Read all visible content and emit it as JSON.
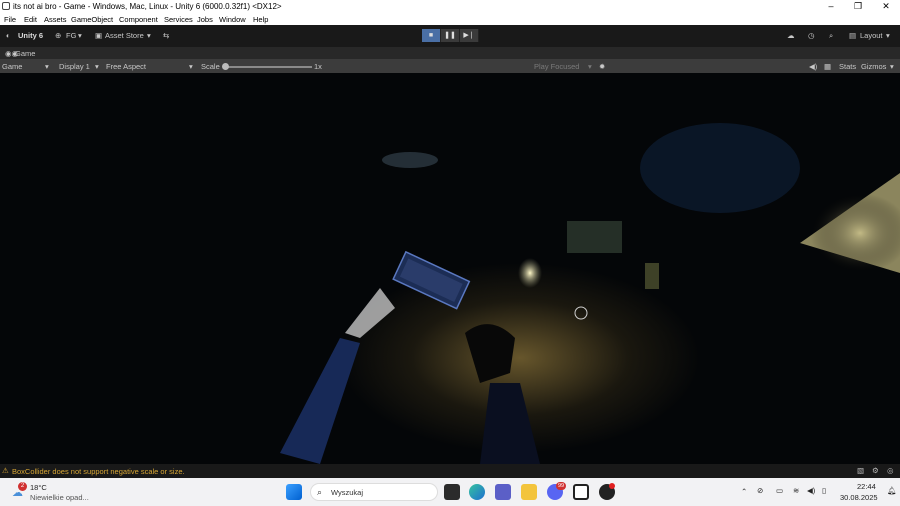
{
  "window": {
    "title": "its not ai bro - Game - Windows, Mac, Linux - Unity 6 (6000.0.32f1) <DX12>",
    "min_glyph": "–",
    "max_glyph": "❐",
    "close_glyph": "✕"
  },
  "menu": [
    "File",
    "Edit",
    "Assets",
    "GameObject",
    "Component",
    "Services",
    "Jobs",
    "Window",
    "Help"
  ],
  "toolbar": {
    "account": "Unity 6",
    "account_icon": "unity-logo-icon",
    "user": "FG",
    "asset_store": "Asset Store",
    "layout": "Layout"
  },
  "tab": {
    "label": "Game"
  },
  "gamebar": {
    "mode": "Game",
    "display": "Display 1",
    "aspect": "Free Aspect",
    "scale_label": "Scale",
    "scale_value": "1x",
    "scale_fraction": 0.0,
    "play_focused": "Play Focused",
    "stats": "Stats",
    "gizmos": "Gizmos"
  },
  "console": {
    "message": "BoxCollider does not support negative scale or size."
  },
  "taskbar": {
    "weather_badge": "2",
    "temp": "18°C",
    "weather_desc": "Niewielkie opad...",
    "search_placeholder": "Wyszukaj",
    "discord_badge": "99",
    "time": "22:44",
    "date": "30.08.2025"
  },
  "colors": {
    "toolbar_bg": "#191919",
    "gamebar_bg": "#3c3c3c",
    "warning": "#d7a635",
    "play_active": "#4a6fa5"
  }
}
